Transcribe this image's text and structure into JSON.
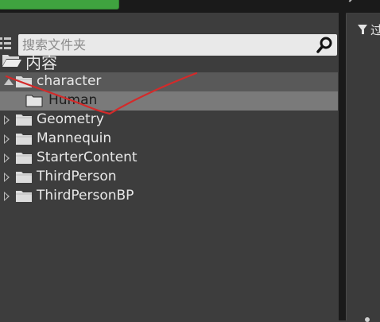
{
  "search": {
    "placeholder": "搜索文件夹"
  },
  "tree": {
    "root_label": "内容",
    "items": [
      {
        "label": "character",
        "expanded": true,
        "selected": true
      },
      {
        "label": "Human",
        "child": true,
        "selected": true
      },
      {
        "label": "Geometry"
      },
      {
        "label": "Mannequin"
      },
      {
        "label": "StarterContent"
      },
      {
        "label": "ThirdPerson"
      },
      {
        "label": "ThirdPersonBP"
      }
    ]
  },
  "right_panel": {
    "filter_label": "过"
  },
  "icons": {
    "list": "list-icon",
    "search": "search-icon",
    "filter": "filter-icon",
    "folder_open": "folder-open-icon",
    "folder": "folder-icon",
    "expand": "expand-arrow-icon",
    "collapse": "collapse-arrow-icon"
  },
  "colors": {
    "panel_bg": "#3d3d3d",
    "selection": "#595959",
    "selection_child": "#7a7a7a",
    "annotation": "#d42a2a",
    "accent_green": "#3fa33f"
  }
}
